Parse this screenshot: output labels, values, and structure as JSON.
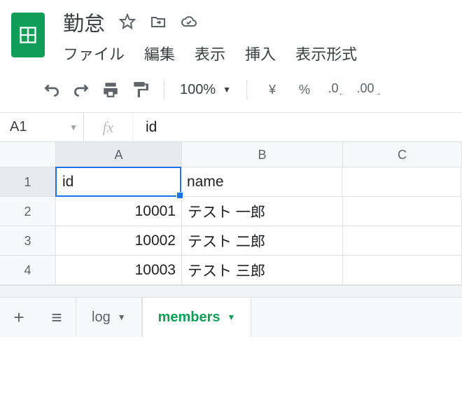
{
  "doc": {
    "title": "勤怠"
  },
  "menus": [
    "ファイル",
    "編集",
    "表示",
    "挿入",
    "表示形式"
  ],
  "toolbar": {
    "zoom": "100%",
    "currency": "¥",
    "percent": "%",
    "dec_dec": ".0",
    "dec_inc": ".00"
  },
  "namebox": "A1",
  "fx": {
    "label": "fx",
    "value": "id"
  },
  "columns": [
    "A",
    "B",
    "C"
  ],
  "rows": [
    {
      "n": "1",
      "A": "id",
      "B": "name",
      "C": ""
    },
    {
      "n": "2",
      "A": "10001",
      "B": "テスト 一郎",
      "C": ""
    },
    {
      "n": "3",
      "A": "10002",
      "B": "テスト 二郎",
      "C": ""
    },
    {
      "n": "4",
      "A": "10003",
      "B": "テスト 三郎",
      "C": ""
    }
  ],
  "sheets": {
    "add": "+",
    "all": "≡",
    "tabs": [
      {
        "label": "log",
        "active": false
      },
      {
        "label": "members",
        "active": true
      }
    ]
  }
}
